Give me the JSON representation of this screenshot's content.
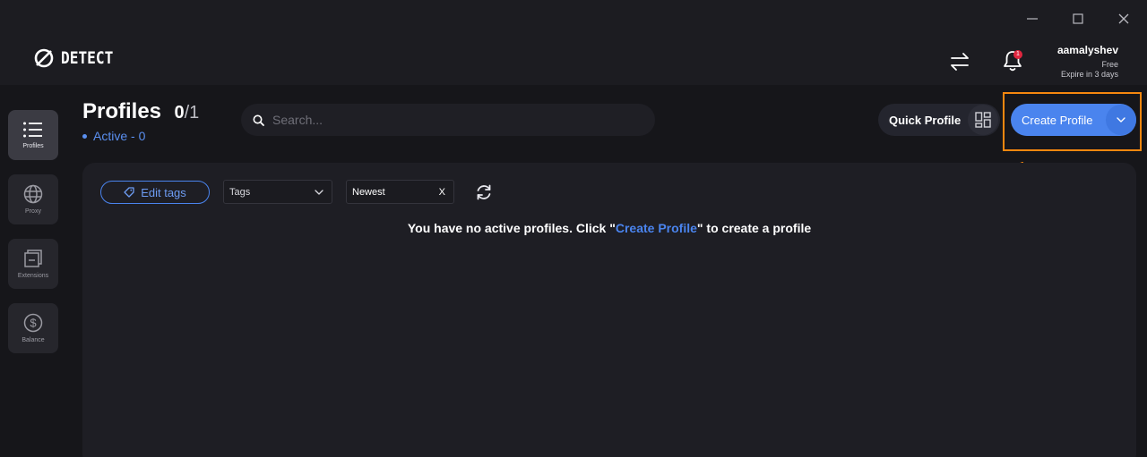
{
  "window": {
    "controls": [
      "minimize",
      "maximize",
      "close"
    ]
  },
  "header": {
    "logo_text": "DETECT",
    "notifications_count": "1",
    "user": {
      "name": "aamalyshev",
      "plan": "Free",
      "expire": "Expire in 3 days"
    }
  },
  "sidebar": {
    "items": [
      {
        "label": "Profiles",
        "icon": "list-icon",
        "active": true
      },
      {
        "label": "Proxy",
        "icon": "globe-icon",
        "active": false
      },
      {
        "label": "Extensions",
        "icon": "extensions-icon",
        "active": false
      },
      {
        "label": "Balance",
        "icon": "dollar-icon",
        "active": false
      }
    ]
  },
  "toolbar": {
    "title": "Profiles",
    "count_current": "0",
    "count_max": "/1",
    "active_label": "Active - 0",
    "search_placeholder": "Search...",
    "quick_profile_label": "Quick Profile",
    "create_profile_label": "Create Profile"
  },
  "filters": {
    "edit_tags_label": "Edit tags",
    "tags_label": "Tags",
    "sort_value": "Newest",
    "sort_clear": "X"
  },
  "empty_state": {
    "prefix": "You have no active profiles. Click \"",
    "link": "Create Profile",
    "suffix": "\" to create a profile"
  },
  "colors": {
    "accent": "#4a84ee",
    "highlight": "#f5870f",
    "badge": "#e0263f",
    "background": "#1c1c21"
  }
}
